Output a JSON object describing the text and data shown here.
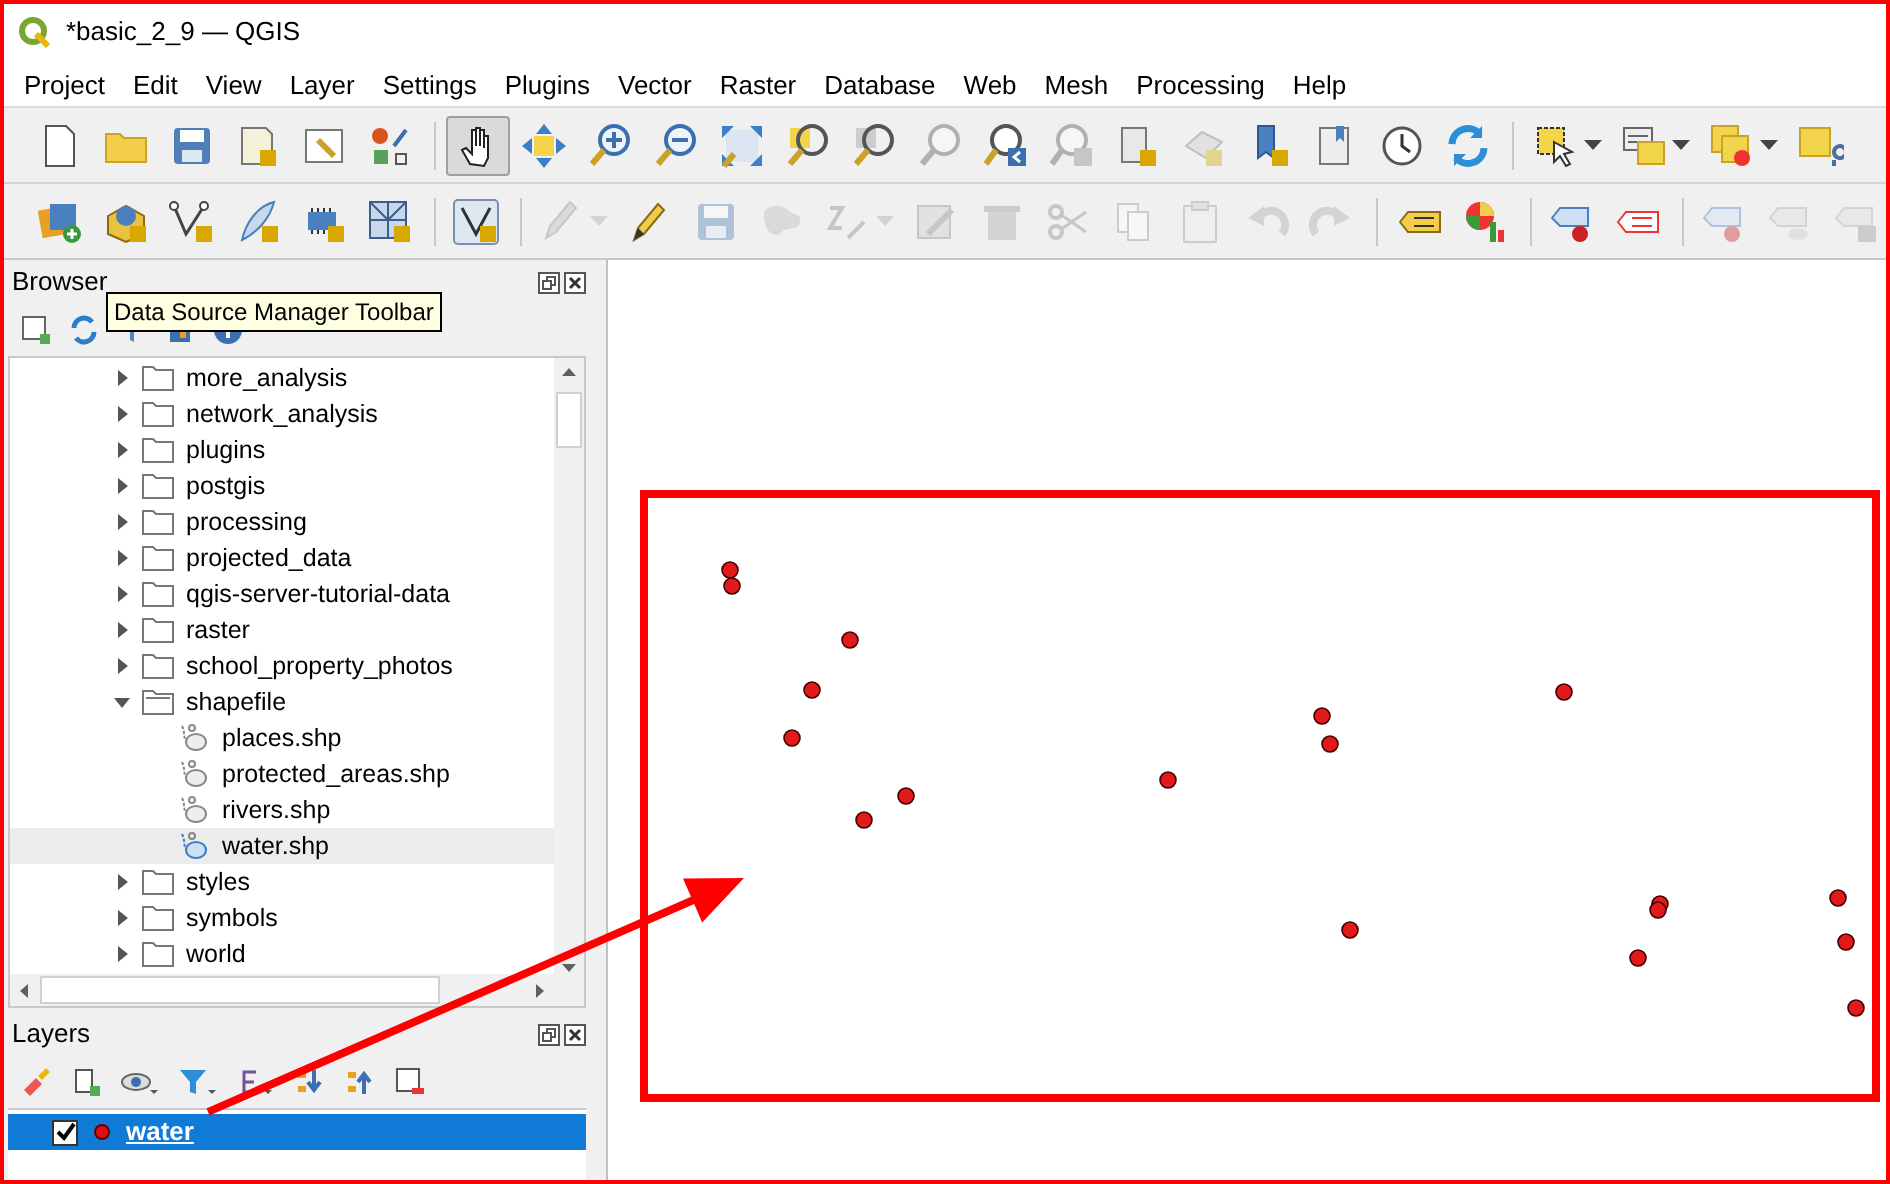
{
  "window": {
    "title": "*basic_2_9 — QGIS"
  },
  "menu": [
    "Project",
    "Edit",
    "View",
    "Layer",
    "Settings",
    "Plugins",
    "Vector",
    "Raster",
    "Database",
    "Web",
    "Mesh",
    "Processing",
    "Help"
  ],
  "toolbar_1": [
    {
      "kind": "new-file",
      "disabled": false
    },
    {
      "kind": "folder",
      "disabled": false
    },
    {
      "kind": "save",
      "disabled": false
    },
    {
      "kind": "template",
      "disabled": false
    },
    {
      "kind": "properties",
      "disabled": false
    },
    {
      "kind": "style",
      "disabled": false
    },
    {
      "kind": "separator"
    },
    {
      "kind": "pan",
      "disabled": false,
      "selected": true
    },
    {
      "kind": "pan-arrows",
      "disabled": false,
      "selected": false
    },
    {
      "kind": "zoom-in",
      "disabled": false,
      "selected": false
    },
    {
      "kind": "zoom-out",
      "disabled": false,
      "selected": false
    },
    {
      "kind": "full-extent",
      "disabled": false,
      "selected": false
    },
    {
      "kind": "zoom-selection",
      "disabled": false,
      "selected": false
    },
    {
      "kind": "zoom-layer",
      "disabled": false,
      "selected": false
    },
    {
      "kind": "zoom-native",
      "disabled": true,
      "selected": false
    },
    {
      "kind": "zoom-last",
      "disabled": false,
      "selected": false
    },
    {
      "kind": "zoom-next",
      "disabled": true,
      "selected": false
    },
    {
      "kind": "map-view",
      "disabled": false
    },
    {
      "kind": "map-3d",
      "disabled": true
    },
    {
      "kind": "bookmark",
      "disabled": false
    },
    {
      "kind": "bookmarks",
      "disabled": false
    },
    {
      "kind": "clock",
      "disabled": false
    },
    {
      "kind": "refresh",
      "disabled": false
    },
    {
      "kind": "separator"
    },
    {
      "kind": "select",
      "disabled": false,
      "dropdown": true
    },
    {
      "kind": "attributes",
      "disabled": false,
      "dropdown": true
    },
    {
      "kind": "deselect",
      "disabled": false,
      "dropdown": true
    },
    {
      "kind": "pin",
      "disabled": false
    }
  ],
  "toolbar_2": [
    {
      "kind": "add-layers",
      "disabled": false
    },
    {
      "kind": "globe",
      "disabled": false
    },
    {
      "kind": "vertex",
      "disabled": false
    },
    {
      "kind": "feather",
      "disabled": false
    },
    {
      "kind": "chip",
      "disabled": false
    },
    {
      "kind": "grid",
      "disabled": false
    },
    {
      "kind": "separator"
    },
    {
      "kind": "vertex-tool",
      "disabled": false
    },
    {
      "kind": "separator"
    },
    {
      "kind": "pencils",
      "disabled": true,
      "dropdown": true
    },
    {
      "kind": "pencil",
      "disabled": false
    },
    {
      "kind": "save",
      "disabled": true
    },
    {
      "kind": "blob",
      "disabled": true
    },
    {
      "kind": "digitize",
      "disabled": true,
      "dropdown": true
    },
    {
      "kind": "edit-table",
      "disabled": true
    },
    {
      "kind": "trash",
      "disabled": true
    },
    {
      "kind": "scissors",
      "disabled": true
    },
    {
      "kind": "copy",
      "disabled": true
    },
    {
      "kind": "paste",
      "disabled": true
    },
    {
      "kind": "undo",
      "disabled": true
    },
    {
      "kind": "redo",
      "disabled": true
    },
    {
      "kind": "separator"
    },
    {
      "kind": "label",
      "disabled": false
    },
    {
      "kind": "diagram",
      "disabled": false
    },
    {
      "kind": "separator"
    },
    {
      "kind": "label-pin",
      "disabled": false
    },
    {
      "kind": "label-remove",
      "disabled": false
    },
    {
      "kind": "separator"
    },
    {
      "kind": "label-pin",
      "disabled": true
    },
    {
      "kind": "label-eye",
      "disabled": true
    },
    {
      "kind": "label-move",
      "disabled": true
    }
  ],
  "browser": {
    "title": "Browser",
    "tooltip": "Data Source Manager Toolbar",
    "items": [
      {
        "label": "more_analysis",
        "kind": "folder",
        "expanded": false,
        "selected": false
      },
      {
        "label": "network_analysis",
        "kind": "folder",
        "expanded": false,
        "selected": false
      },
      {
        "label": "plugins",
        "kind": "folder",
        "expanded": false,
        "selected": false
      },
      {
        "label": "postgis",
        "kind": "folder",
        "expanded": false,
        "selected": false
      },
      {
        "label": "processing",
        "kind": "folder",
        "expanded": false,
        "selected": false
      },
      {
        "label": "projected_data",
        "kind": "folder",
        "expanded": false,
        "selected": false
      },
      {
        "label": "qgis-server-tutorial-data",
        "kind": "folder",
        "expanded": false,
        "selected": false
      },
      {
        "label": "raster",
        "kind": "folder",
        "expanded": false,
        "selected": false
      },
      {
        "label": "school_property_photos",
        "kind": "folder",
        "expanded": false,
        "selected": false
      },
      {
        "label": "shapefile",
        "kind": "folder",
        "expanded": true,
        "selected": false,
        "children": [
          {
            "label": "places.shp",
            "kind": "file",
            "selected": false
          },
          {
            "label": "protected_areas.shp",
            "kind": "file",
            "selected": false
          },
          {
            "label": "rivers.shp",
            "kind": "file",
            "selected": false
          },
          {
            "label": "water.shp",
            "kind": "file",
            "selected": true
          }
        ]
      },
      {
        "label": "styles",
        "kind": "folder",
        "expanded": false,
        "selected": false
      },
      {
        "label": "symbols",
        "kind": "folder",
        "expanded": false,
        "selected": false
      },
      {
        "label": "world",
        "kind": "folder",
        "expanded": false,
        "selected": false
      }
    ]
  },
  "layers": {
    "title": "Layers",
    "items": [
      {
        "label": "water",
        "visible": true,
        "selected": true
      }
    ]
  }
}
